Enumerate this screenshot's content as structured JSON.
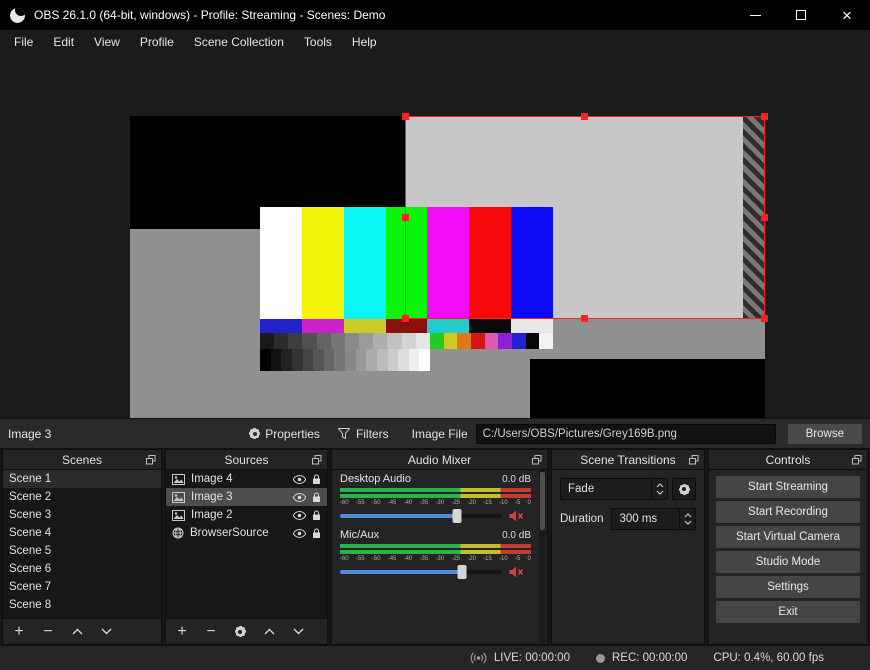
{
  "colors": {
    "accent_blue": "#4a90d9",
    "selection_red": "#ff1f1f",
    "meter_green": "#2bb34b",
    "meter_yellow": "#c5bd2a",
    "meter_red": "#c43a31",
    "mute_red": "#d84040"
  },
  "window": {
    "title": "OBS 26.1.0 (64-bit, windows) - Profile: Streaming - Scenes: Demo"
  },
  "menu": {
    "items": [
      "File",
      "Edit",
      "View",
      "Profile",
      "Scene Collection",
      "Tools",
      "Help"
    ]
  },
  "toolbar": {
    "selected_source": "Image 3",
    "properties_label": "Properties",
    "filters_label": "Filters",
    "image_file_label": "Image File",
    "image_file_value": "C:/Users/OBS/Pictures/Grey169B.png",
    "browse_label": "Browse"
  },
  "scenes": {
    "title": "Scenes",
    "selected_index": 0,
    "items": [
      "Scene 1",
      "Scene 2",
      "Scene 3",
      "Scene 4",
      "Scene 5",
      "Scene 6",
      "Scene 7",
      "Scene 8"
    ]
  },
  "sources": {
    "title": "Sources",
    "items": [
      {
        "label": "Image 4",
        "type": "image",
        "selected": false
      },
      {
        "label": "Image 3",
        "type": "image",
        "selected": true
      },
      {
        "label": "Image 2",
        "type": "image",
        "selected": false
      },
      {
        "label": "BrowserSource",
        "type": "browser",
        "selected": false
      }
    ]
  },
  "mixer": {
    "title": "Audio Mixer",
    "scale": [
      "-60",
      "-55",
      "-50",
      "-45",
      "-40",
      "-35",
      "-30",
      "-25",
      "-20",
      "-15",
      "-10",
      "-5",
      "0"
    ],
    "channels": [
      {
        "name": "Desktop Audio",
        "db": "0.0 dB",
        "slider_pct": 72,
        "muted": true
      },
      {
        "name": "Mic/Aux",
        "db": "0.0 dB",
        "slider_pct": 75,
        "muted": true
      }
    ]
  },
  "transitions": {
    "title": "Scene Transitions",
    "transition": "Fade",
    "duration_label": "Duration",
    "duration_value": "300 ms"
  },
  "controls_panel": {
    "title": "Controls",
    "buttons": [
      "Start Streaming",
      "Start Recording",
      "Start Virtual Camera",
      "Studio Mode",
      "Settings",
      "Exit"
    ]
  },
  "statusbar": {
    "live": "LIVE: 00:00:00",
    "rec": "REC: 00:00:00",
    "cpu": "CPU: 0.4%, 60.00 fps"
  },
  "preview": {
    "bars": [
      "#ffffff",
      "#f5f50a",
      "#0af5f5",
      "#0af50a",
      "#f50af5",
      "#f50a0a",
      "#0a0af5"
    ],
    "row2": [
      "#2222cc",
      "#cc22cc",
      "#cccc22",
      "#8a1010",
      "#22cccc",
      "#0a0a0a",
      "#e8e8e8"
    ],
    "row3_left_steps": 12,
    "row3_right": [
      "#22cc22",
      "#cccc22",
      "#e07818",
      "#d41414",
      "#e058b0",
      "#8a22d4",
      "#2222d4",
      "#060606",
      "#f2f2f2"
    ],
    "row4_steps": 16
  }
}
